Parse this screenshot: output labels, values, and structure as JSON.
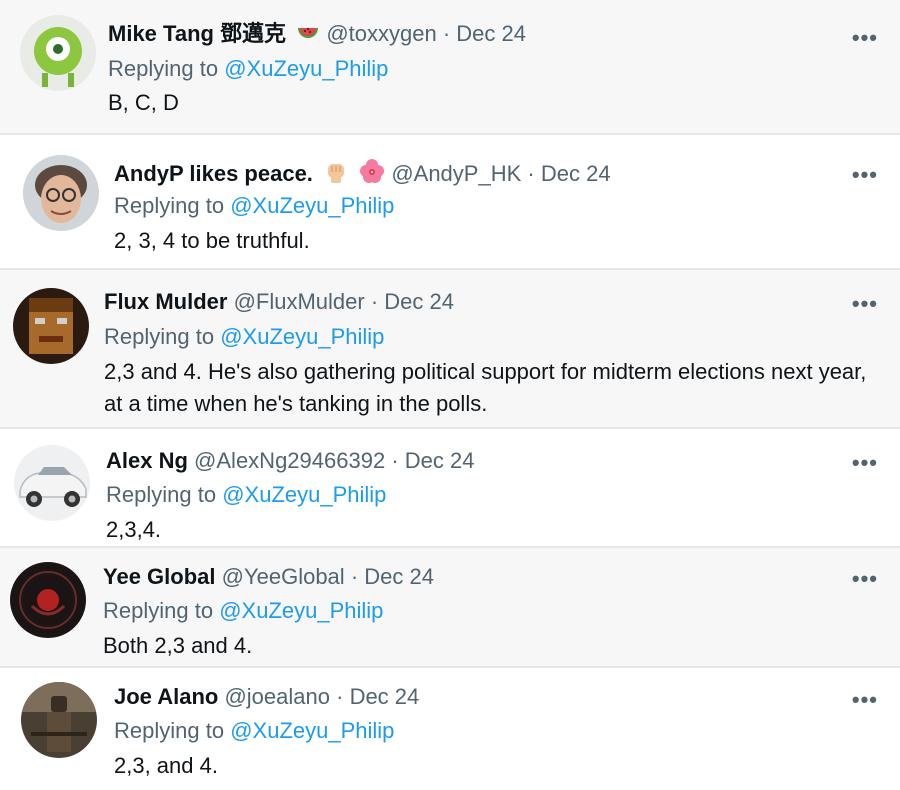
{
  "reply_prefix": "Replying to",
  "more_label": "•••",
  "replies": [
    {
      "name": "Mike Tang 鄧邁克",
      "handle": "@toxxygen",
      "dot": "·",
      "date": "Dec 24",
      "mention": "@XuZeyu_Philip",
      "text": "B, C, D",
      "emojis": [
        "watermelon-icon"
      ]
    },
    {
      "name": "AndyP likes peace.",
      "handle": "@AndyP_HK",
      "dot": "·",
      "date": "Dec 24",
      "mention": "@XuZeyu_Philip",
      "text": "2, 3, 4 to be truthful.",
      "emojis": [
        "raised-fist-icon",
        "hibiscus-icon"
      ]
    },
    {
      "name": "Flux Mulder",
      "handle": "@FluxMulder",
      "dot": "·",
      "date": "Dec 24",
      "mention": "@XuZeyu_Philip",
      "text": "2,3 and 4. He's also gathering political support for midterm elections next year, at a time when he's tanking in the polls."
    },
    {
      "name": "Alex Ng",
      "handle": "@AlexNg29466392",
      "dot": "·",
      "date": "Dec 24",
      "mention": "@XuZeyu_Philip",
      "text": "2,3,4."
    },
    {
      "name": "Yee Global",
      "handle": "@YeeGlobal",
      "dot": "·",
      "date": "Dec 24",
      "mention": "@XuZeyu_Philip",
      "text": "Both 2,3 and 4."
    },
    {
      "name": "Joe Alano",
      "handle": "@joealano",
      "dot": "·",
      "date": "Dec 24",
      "mention": "@XuZeyu_Philip",
      "text": "2,3, and 4."
    }
  ]
}
